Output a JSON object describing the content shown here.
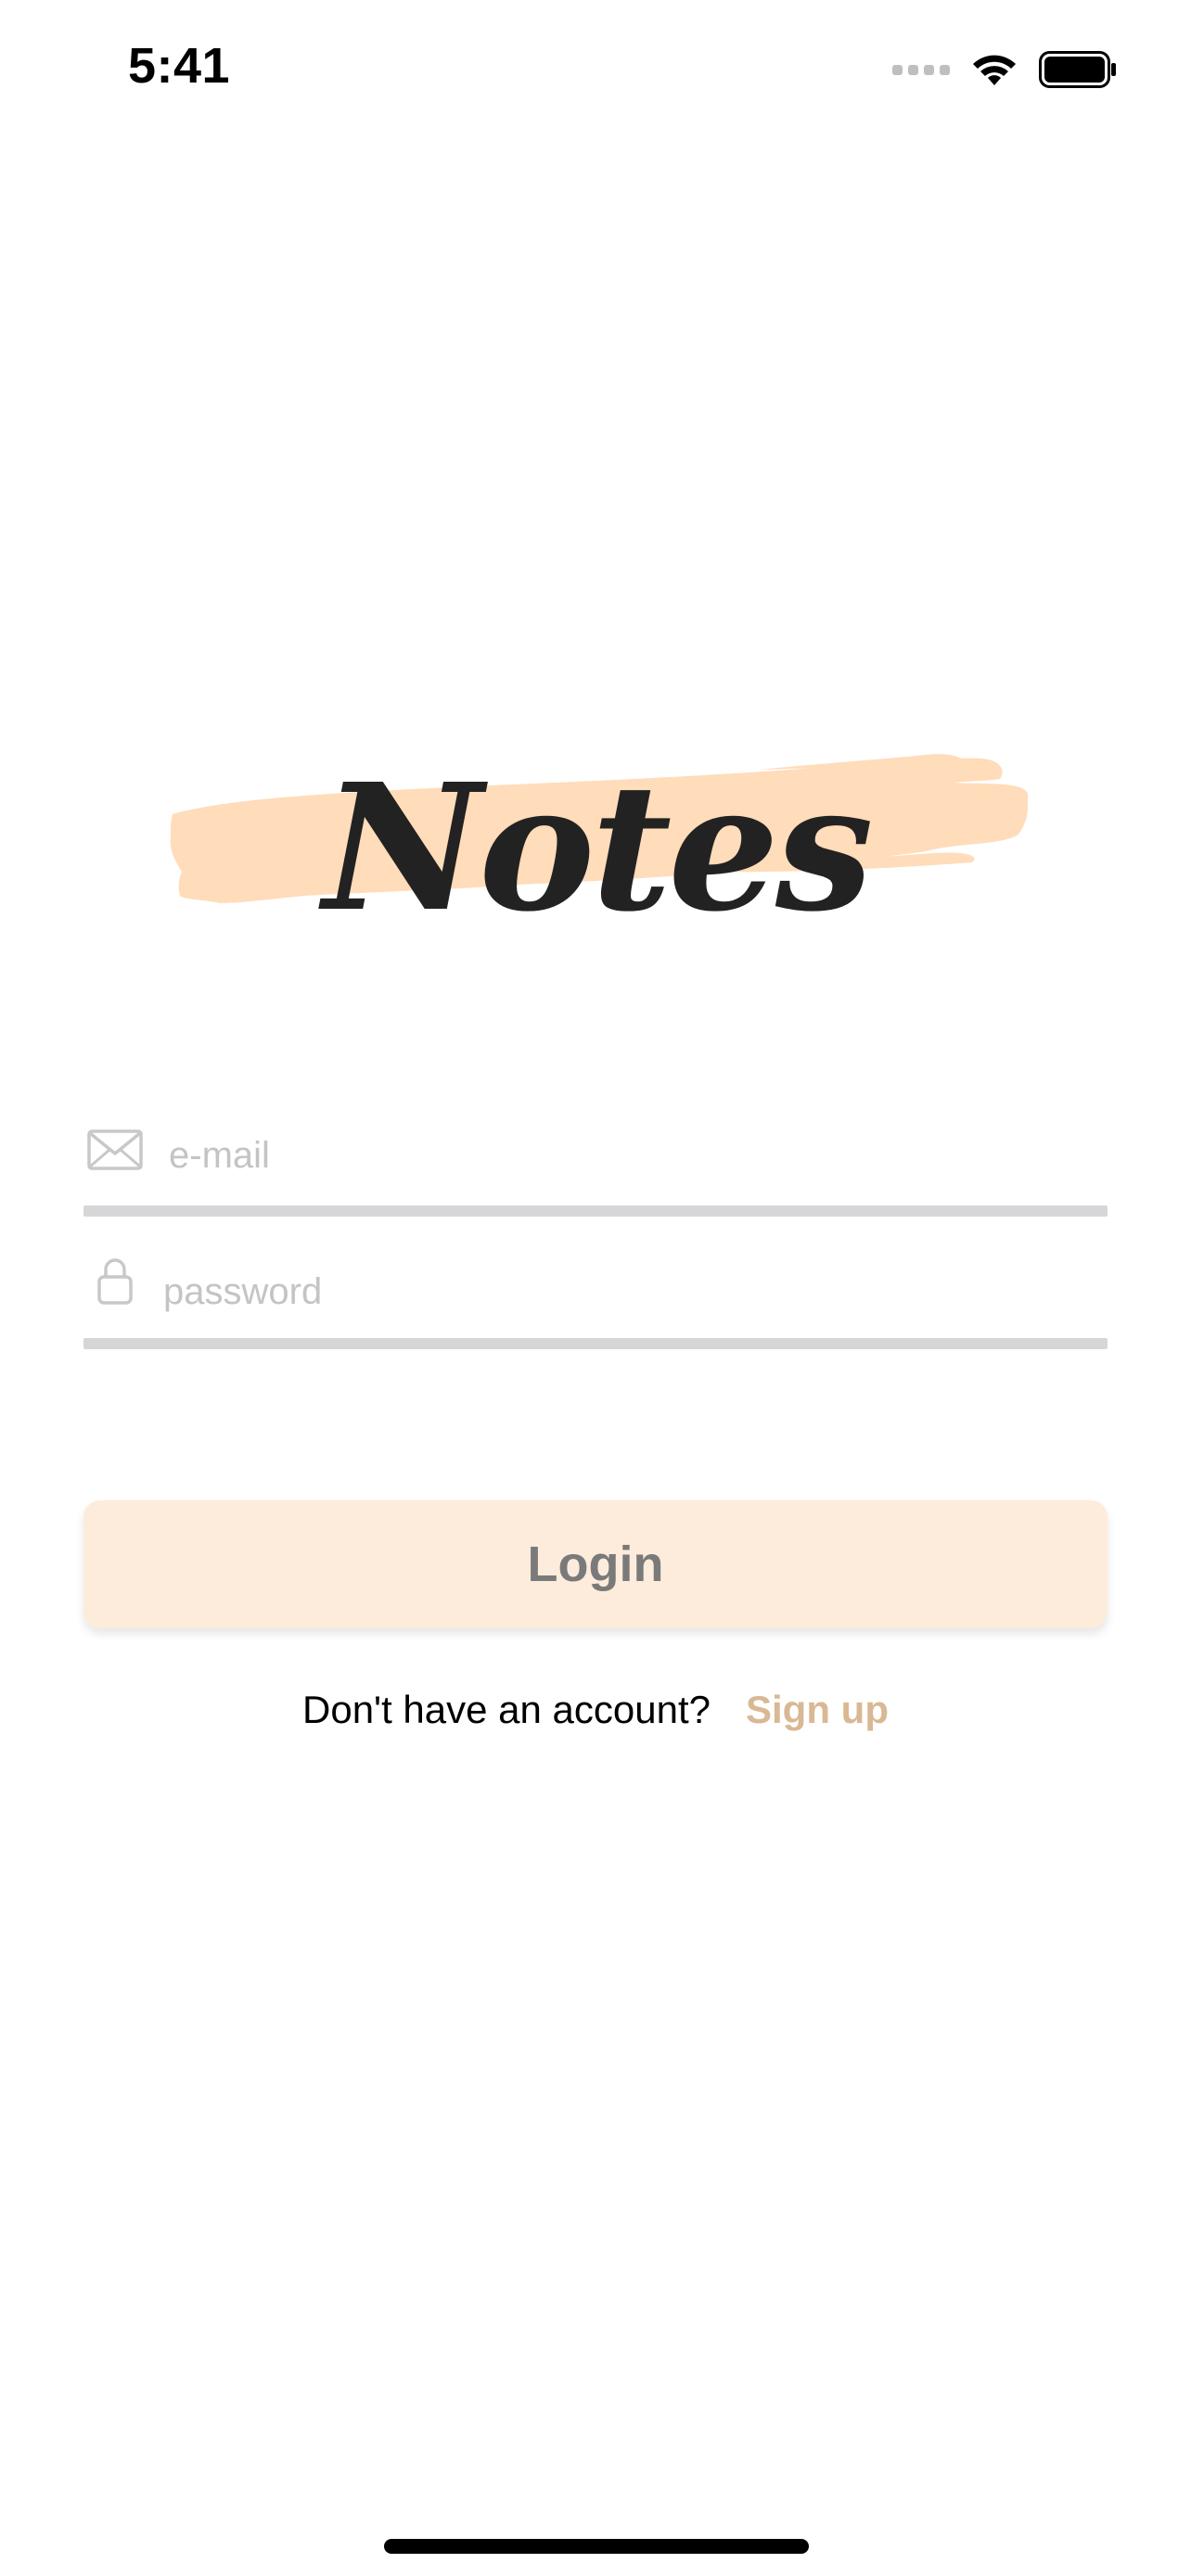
{
  "status_bar": {
    "time": "5:41"
  },
  "logo": {
    "text": "Notes",
    "brush_color": "#ffdcba"
  },
  "form": {
    "email": {
      "placeholder": "e-mail",
      "value": "",
      "icon": "envelope-icon"
    },
    "password": {
      "placeholder": "password",
      "value": "",
      "icon": "lock-icon"
    },
    "login_label": "Login"
  },
  "signup": {
    "question": "Don't have an account?",
    "link_label": "Sign up"
  },
  "colors": {
    "accent": "#d9b894",
    "button_bg": "#fdecdc",
    "underline": "#d6d6d8",
    "placeholder": "#c4c4c6"
  }
}
